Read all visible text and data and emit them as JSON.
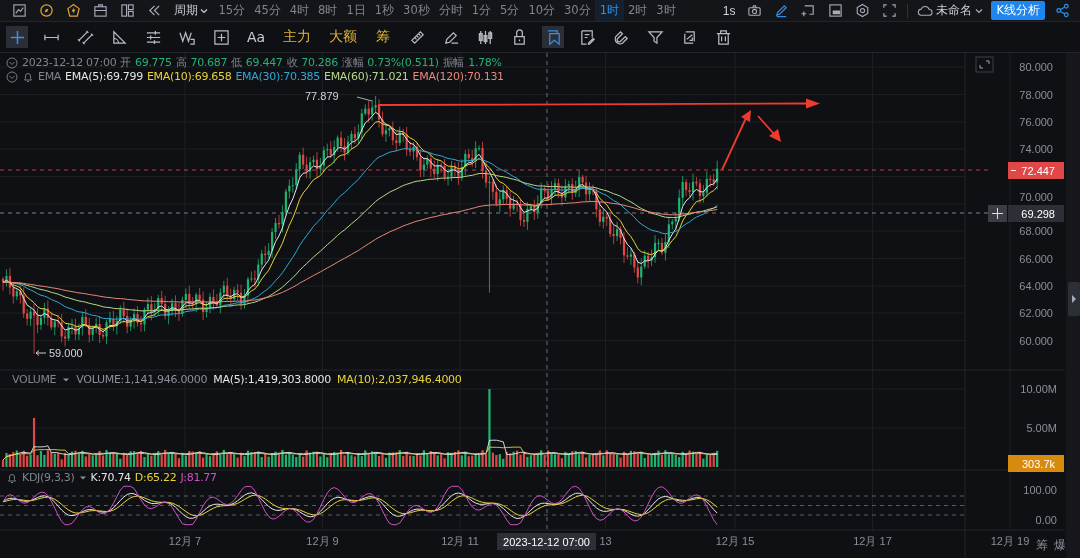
{
  "top_bar": {
    "period_label": "周期",
    "intervals": [
      {
        "label": "15分",
        "selected": false
      },
      {
        "label": "45分",
        "selected": false
      },
      {
        "label": "4时",
        "selected": false
      },
      {
        "label": "8时",
        "selected": false
      },
      {
        "label": "1日",
        "selected": false
      },
      {
        "label": "1秒",
        "selected": false
      },
      {
        "label": "30秒",
        "selected": false
      },
      {
        "label": "分时",
        "selected": false
      },
      {
        "label": "1分",
        "selected": false
      },
      {
        "label": "5分",
        "selected": false
      },
      {
        "label": "10分",
        "selected": false
      },
      {
        "label": "30分",
        "selected": false
      },
      {
        "label": "1时",
        "selected": true
      },
      {
        "label": "2时",
        "selected": false
      },
      {
        "label": "3时",
        "selected": false
      }
    ],
    "refresh_label": "1s",
    "layout_name": "未命名",
    "analysis_button": "K线分析"
  },
  "toolbar": [
    {
      "kind": "crosshair",
      "selected": true
    },
    {
      "kind": "hline",
      "selected": false
    },
    {
      "kind": "parallel",
      "selected": false
    },
    {
      "kind": "triangle",
      "selected": false
    },
    {
      "kind": "levels",
      "selected": false
    },
    {
      "kind": "wave",
      "selected": false
    },
    {
      "kind": "boxplus",
      "selected": false
    },
    {
      "kind": "text",
      "label": "Aa",
      "selected": false
    },
    {
      "kind": "feature",
      "label": "主力",
      "selected": false
    },
    {
      "kind": "feature",
      "label": "大额",
      "selected": false
    },
    {
      "kind": "feature",
      "label": "筹",
      "selected": false
    },
    {
      "kind": "ruler",
      "selected": false
    },
    {
      "kind": "pen",
      "selected": false
    },
    {
      "kind": "candles",
      "selected": false
    },
    {
      "kind": "lock",
      "selected": false
    },
    {
      "kind": "bookmark",
      "selected": true
    },
    {
      "kind": "note",
      "selected": false
    },
    {
      "kind": "magnet",
      "selected": false
    },
    {
      "kind": "filter",
      "selected": false
    },
    {
      "kind": "sync",
      "selected": false
    },
    {
      "kind": "trash",
      "selected": false
    }
  ],
  "ohlc": {
    "date": "2023-12-12 07:00",
    "fields": [
      {
        "label": "开",
        "value": "69.775"
      },
      {
        "label": "高",
        "value": "70.687"
      },
      {
        "label": "低",
        "value": "69.447"
      },
      {
        "label": "收",
        "value": "70.286"
      },
      {
        "label": "涨幅",
        "value": "0.73%(0.511)"
      },
      {
        "label": "振幅",
        "value": "1.78%"
      }
    ]
  },
  "ema": {
    "label": "EMA",
    "values": [
      {
        "text": "EMA(5):69.799",
        "color": "#e6e6e6"
      },
      {
        "text": "EMA(10):69.658",
        "color": "#e8d33a"
      },
      {
        "text": "EMA(30):70.385",
        "color": "#2ea8d8"
      },
      {
        "text": "EMA(60):71.021",
        "color": "#b5d98a"
      },
      {
        "text": "EMA(120):70.131",
        "color": "#e8877a"
      }
    ]
  },
  "price_axis": {
    "ticks": [
      "80.000",
      "78.000",
      "76.000",
      "74.000",
      "70.000",
      "68.000",
      "66.000",
      "64.000",
      "62.000",
      "60.000"
    ],
    "last_price": "72.447",
    "crosshair_price": "69.298"
  },
  "price_marks": {
    "high": "77.879",
    "low": "59.000"
  },
  "volume": {
    "label": "VOLUME",
    "values": [
      {
        "text": "VOLUME:1,141,946.0000",
        "color": "#8a8f99"
      },
      {
        "text": "MA(5):1,419,303.8000",
        "color": "#e6e6e6"
      },
      {
        "text": "MA(10):2,037,946.4000",
        "color": "#e8d33a"
      }
    ],
    "ticks": [
      "10.00M",
      "5.00M"
    ],
    "last": "303.7k"
  },
  "kdj": {
    "label": "KDJ(9,3,3)",
    "values": [
      {
        "text": "K:70.74",
        "color": "#e6e6e6"
      },
      {
        "text": "D:65.22",
        "color": "#e8d33a"
      },
      {
        "text": "J:81.77",
        "color": "#d050c8"
      }
    ],
    "ticks": [
      "100.00",
      "0.00"
    ]
  },
  "time_axis": {
    "labels": [
      "12月 7",
      "12月 9",
      "12月 11",
      "13",
      "12月 15",
      "12月 17",
      "12月 19"
    ],
    "crosshair_time": "2023-12-12 07:00"
  },
  "corner_buttons": [
    "筹",
    "爆"
  ]
}
